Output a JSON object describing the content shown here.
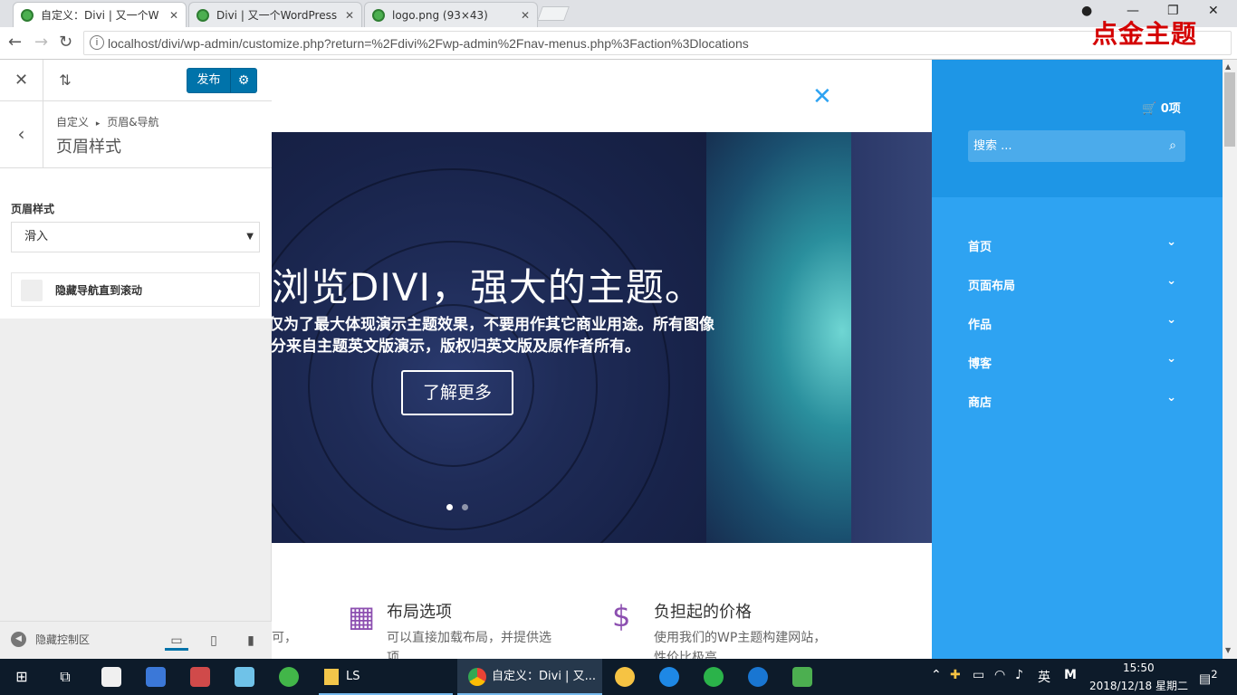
{
  "browser": {
    "tabs": [
      {
        "title": "自定义：Divi | 又一个W",
        "active": true
      },
      {
        "title": "Divi | 又一个WordPress",
        "active": false
      },
      {
        "title": "logo.png (93×43)",
        "active": false
      }
    ],
    "url": "localhost/divi/wp-admin/customize.php?return=%2Fdivi%2Fwp-admin%2Fnav-menus.php%3Faction%3Dlocations",
    "watermark": "点金主题"
  },
  "customizer": {
    "publish_label": "发布",
    "breadcrumb_root": "自定义",
    "breadcrumb_sep": "▸",
    "breadcrumb_parent": "页眉&导航",
    "section_title": "页眉样式",
    "field_label": "页眉样式",
    "select_value": "滑入",
    "checkbox_label": "隐藏导航直到滚动",
    "hide_controls": "隐藏控制区"
  },
  "preview": {
    "hero_heading": "浏览DIVI，强大的主题。",
    "hero_line1": "仅为了最大体现演示主题效果，不要用作其它商业用途。所有图像",
    "hero_line2": "部分来自主题英文版演示，版权归英文版及原作者所有。",
    "hero_button": "了解更多",
    "slide_count": 2,
    "active_slide": 1,
    "blurb_left_partial": "可，",
    "blurbs": [
      {
        "title": "布局选项",
        "desc1": "可以直接加载布局，并提供选",
        "desc2": "项",
        "icon": "calculator-icon"
      },
      {
        "title": "负担起的价格",
        "desc1": "使用我们的WP主题构建网站，",
        "desc2": "性价比极高",
        "icon": "dollar-icon"
      }
    ]
  },
  "slide_panel": {
    "cart": "0项",
    "search_placeholder": "搜索 ...",
    "menu": [
      "首页",
      "页面布局",
      "作品",
      "博客",
      "商店"
    ]
  },
  "taskbar": {
    "ls_label": "LS",
    "chrome_label": "自定义：Divi | 又...",
    "ime": "英",
    "ime_mode": "M",
    "time": "15:50",
    "date": "2018/12/18 星期二",
    "notifications": "2"
  },
  "colors": {
    "wp_blue": "#0073aa",
    "divi_blue": "#2ea3f2",
    "purple_icon": "#8c4fb0"
  }
}
